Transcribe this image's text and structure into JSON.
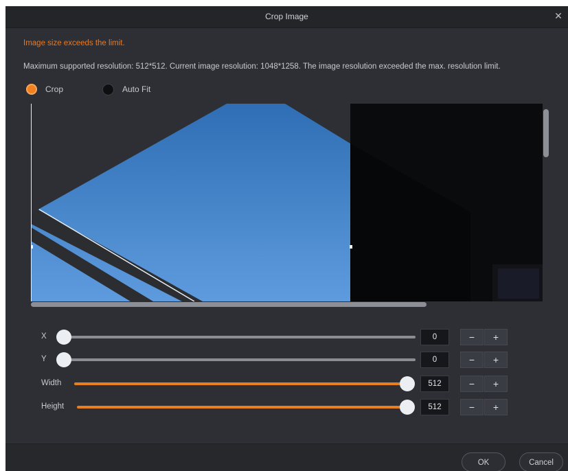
{
  "dialog": {
    "title": "Crop Image",
    "close_icon": "close-icon",
    "warning": "Image size exceeds the limit.",
    "info": "Maximum supported resolution: 512*512. Current image resolution: 1048*1258. The image resolution exceeded the max. resolution limit.",
    "accent_color": "#e77f1e"
  },
  "mode": {
    "selected": "Crop",
    "options": [
      {
        "label": "Crop",
        "selected": true
      },
      {
        "label": "Auto Fit",
        "selected": false
      }
    ]
  },
  "controls": [
    {
      "label": "X",
      "value": "0",
      "position": 0,
      "minus": "−",
      "plus": "+"
    },
    {
      "label": "Y",
      "value": "0",
      "position": 0,
      "minus": "−",
      "plus": "+"
    },
    {
      "label": "Width",
      "value": "512",
      "position": 1,
      "minus": "−",
      "plus": "+"
    },
    {
      "label": "Height",
      "value": "512",
      "position": 1,
      "minus": "−",
      "plus": "+"
    }
  ],
  "footer": {
    "ok": "OK",
    "cancel": "Cancel"
  }
}
